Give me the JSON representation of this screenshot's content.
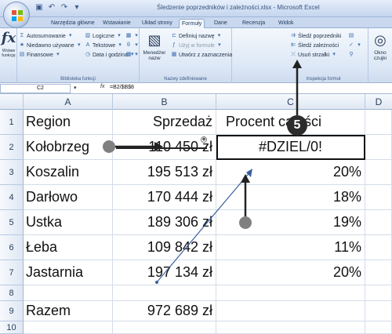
{
  "window": {
    "title": "Śledzenie poprzedników i zależności.xlsx - Microsoft Excel"
  },
  "tabs": [
    {
      "label": "Narzędzia główne",
      "active": false
    },
    {
      "label": "Wstawianie",
      "active": false
    },
    {
      "label": "Układ strony",
      "active": false
    },
    {
      "label": "Formuły",
      "active": true
    },
    {
      "label": "Dane",
      "active": false
    },
    {
      "label": "Recenzja",
      "active": false
    },
    {
      "label": "Widok",
      "active": false
    }
  ],
  "ribbon": {
    "insert_function": {
      "icon": "fx-icon",
      "symbol": "fx",
      "label": "Wstaw funkcję"
    },
    "library": {
      "label": "Biblioteka funkcji",
      "items": [
        {
          "icon": "sigma-icon",
          "label": "Autosumowanie"
        },
        {
          "icon": "star-icon",
          "label": "Niedawno używane"
        },
        {
          "icon": "book-icon",
          "label": "Finansowe"
        },
        {
          "icon": "logical-icon",
          "label": "Logiczne"
        },
        {
          "icon": "text-icon",
          "label": "Tekstowe"
        },
        {
          "icon": "clock-icon",
          "label": "Data i godzina"
        }
      ]
    },
    "names": {
      "label": "Nazwy zdefiniowane",
      "manager": "Menedżer nazw",
      "items": [
        {
          "label": "Definiuj nazwę"
        },
        {
          "label": "Użyj w formule"
        },
        {
          "label": "Utwórz z zaznaczenia"
        }
      ]
    },
    "audit": {
      "label": "Inspekcja formuł",
      "items": [
        {
          "label": "Śledź poprzedniki"
        },
        {
          "label": "Śledź zależności"
        },
        {
          "label": "Usuń strzałki"
        }
      ]
    },
    "watch": {
      "label": "Okno czujki"
    }
  },
  "formula_bar": {
    "name_box": "C2",
    "fx": "fx",
    "formula": "=B2/$B$8"
  },
  "grid": {
    "columns": [
      "A",
      "B",
      "C",
      "D"
    ],
    "rows": [
      {
        "num": "1",
        "a": "Region",
        "b": "Sprzedaż",
        "c": "Procent całości"
      },
      {
        "num": "2",
        "a": "Kołobrzeg",
        "b": "110 450 zł",
        "c": "#DZIEL/0!"
      },
      {
        "num": "3",
        "a": "Koszalin",
        "b": "195 513 zł",
        "c": "20%"
      },
      {
        "num": "4",
        "a": "Darłowo",
        "b": "170 444 zł",
        "c": "18%"
      },
      {
        "num": "5",
        "a": "Ustka",
        "b": "189 306 zł",
        "c": "19%"
      },
      {
        "num": "6",
        "a": "Łeba",
        "b": "109 842 zł",
        "c": "11%"
      },
      {
        "num": "7",
        "a": "Jastarnia",
        "b": "197 134 zł",
        "c": "20%"
      },
      {
        "num": "8",
        "a": "",
        "b": "",
        "c": ""
      },
      {
        "num": "9",
        "a": "Razem",
        "b": "972 689 zł",
        "c": ""
      },
      {
        "num": "10",
        "a": "",
        "b": "",
        "c": ""
      }
    ]
  },
  "annotation": {
    "step_number": "5"
  },
  "colors": {
    "accent": "#c8d8ee",
    "tracer": "#3a5f9e",
    "callout": "#2c2c2c"
  }
}
